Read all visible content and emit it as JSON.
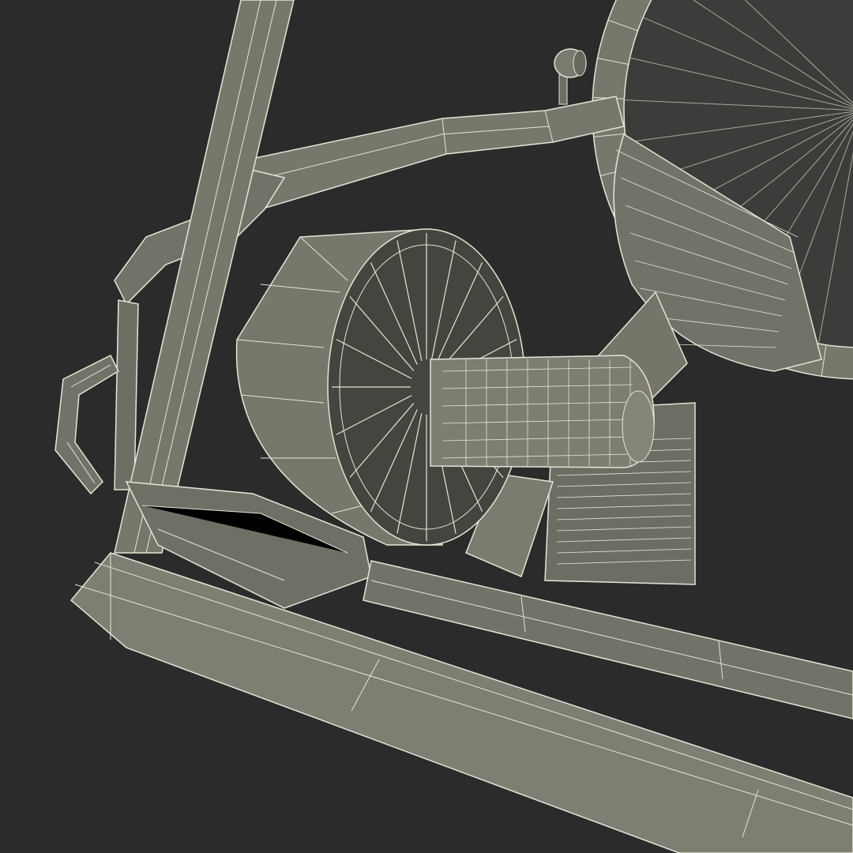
{
  "scene": {
    "subject": "wireframe-3d-model",
    "colors": {
      "background": "#2b2b2b",
      "surface": "#77786c",
      "surface_light": "#8a8b7e",
      "surface_dark": "#5d5e54",
      "wire": "#e6e4d6",
      "glass": "#3c3d3a"
    }
  }
}
